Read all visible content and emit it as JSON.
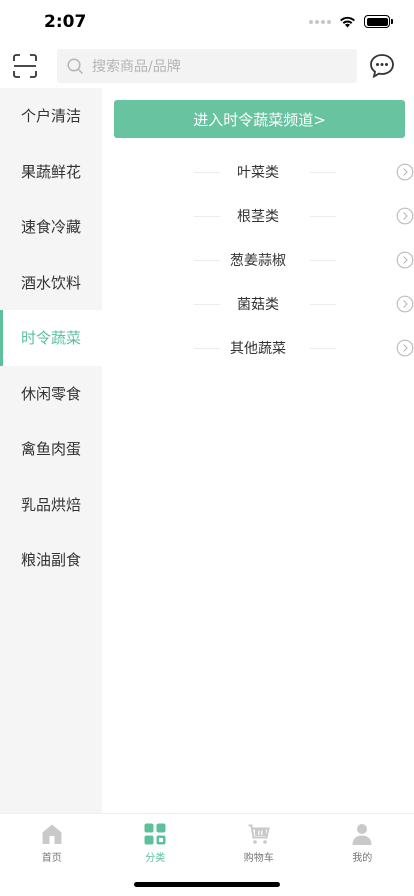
{
  "status_bar": {
    "time": "2:07"
  },
  "search": {
    "placeholder": "搜索商品/品牌"
  },
  "sidebar": {
    "items": [
      {
        "label": "个户清洁"
      },
      {
        "label": "果蔬鲜花"
      },
      {
        "label": "速食冷藏"
      },
      {
        "label": "酒水饮料"
      },
      {
        "label": "时令蔬菜",
        "active": true
      },
      {
        "label": "休闲零食"
      },
      {
        "label": "禽鱼肉蛋"
      },
      {
        "label": "乳品烘焙"
      },
      {
        "label": "粮油副食"
      }
    ]
  },
  "main": {
    "channel_button": "进入时令蔬菜频道>",
    "subcategories": [
      {
        "label": "叶菜类"
      },
      {
        "label": "根茎类"
      },
      {
        "label": "葱姜蒜椒"
      },
      {
        "label": "菌菇类"
      },
      {
        "label": "其他蔬菜"
      }
    ]
  },
  "tabbar": {
    "tabs": [
      {
        "label": "首页",
        "icon": "home-icon"
      },
      {
        "label": "分类",
        "icon": "category-grid-icon",
        "active": true
      },
      {
        "label": "购物车",
        "icon": "cart-icon"
      },
      {
        "label": "我的",
        "icon": "user-icon"
      }
    ]
  },
  "colors": {
    "accent": "#5cc09a",
    "channel_button": "#67c3a0",
    "sidebar_bg": "#f5f5f5"
  }
}
